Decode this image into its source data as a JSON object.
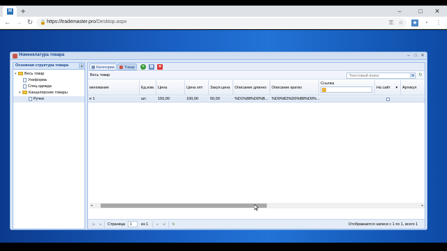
{
  "browser": {
    "tab_favicon": "M",
    "new_tab": "+",
    "controls": {
      "minimize": "–",
      "maximize": "□",
      "close": "✕"
    },
    "nav": {
      "back": "←",
      "forward": "→",
      "reload": "↻"
    },
    "url_host": "https://trademaster.pro",
    "url_path": "/Desktop.aspx",
    "icons": [
      "key-icon",
      "star-icon",
      "extension-icon",
      "profile-icon",
      "menu-icon"
    ]
  },
  "window": {
    "title": "Номенклатура товара",
    "controls": {
      "minimize": "–",
      "maximize": "□",
      "close": "✕"
    }
  },
  "tree": {
    "title": "Основная структура товара",
    "collapse": "◂",
    "nodes": [
      {
        "label": "Весь товар",
        "type": "folder",
        "expander": "▾"
      },
      {
        "label": "Униформа",
        "type": "doc",
        "expander": ""
      },
      {
        "label": "Спец.одежда",
        "type": "doc",
        "expander": ""
      },
      {
        "label": "Канцелярские товары",
        "type": "folder",
        "expander": "▾"
      },
      {
        "label": "Ручки",
        "type": "doc",
        "expander": "",
        "selected": true
      }
    ]
  },
  "toolbar": {
    "categories_label": "Категории",
    "goods_label": "Товар",
    "add": "+",
    "copy": "⧉",
    "delete": "✕"
  },
  "subbar": {
    "title": "Весь товар",
    "search_placeholder": "Текстовый поиск"
  },
  "grid": {
    "columns": [
      "менование",
      "Ед.изм.",
      "Цена",
      "Цена опт",
      "Закуп.цена",
      "Описание длинно",
      "Описание кратко",
      "Ссылка",
      "На сайт",
      "Артикул"
    ],
    "sort_indicator": "▾",
    "rows": [
      [
        "е 1",
        "шт.",
        "150,00",
        "100,00",
        "50,00",
        "%D1%88%D0%B...",
        "%D0%B2%D0%B8%D0%...",
        "",
        "",
        ""
      ]
    ]
  },
  "paging": {
    "first": "|◂",
    "prev": "◂",
    "page_label": "Страница",
    "page_value": "1",
    "of_label": "из 1",
    "next": "▸",
    "last": "▸|",
    "refresh": "↻",
    "summary": "Отображаются записи с 1 по 1, всего 1"
  }
}
